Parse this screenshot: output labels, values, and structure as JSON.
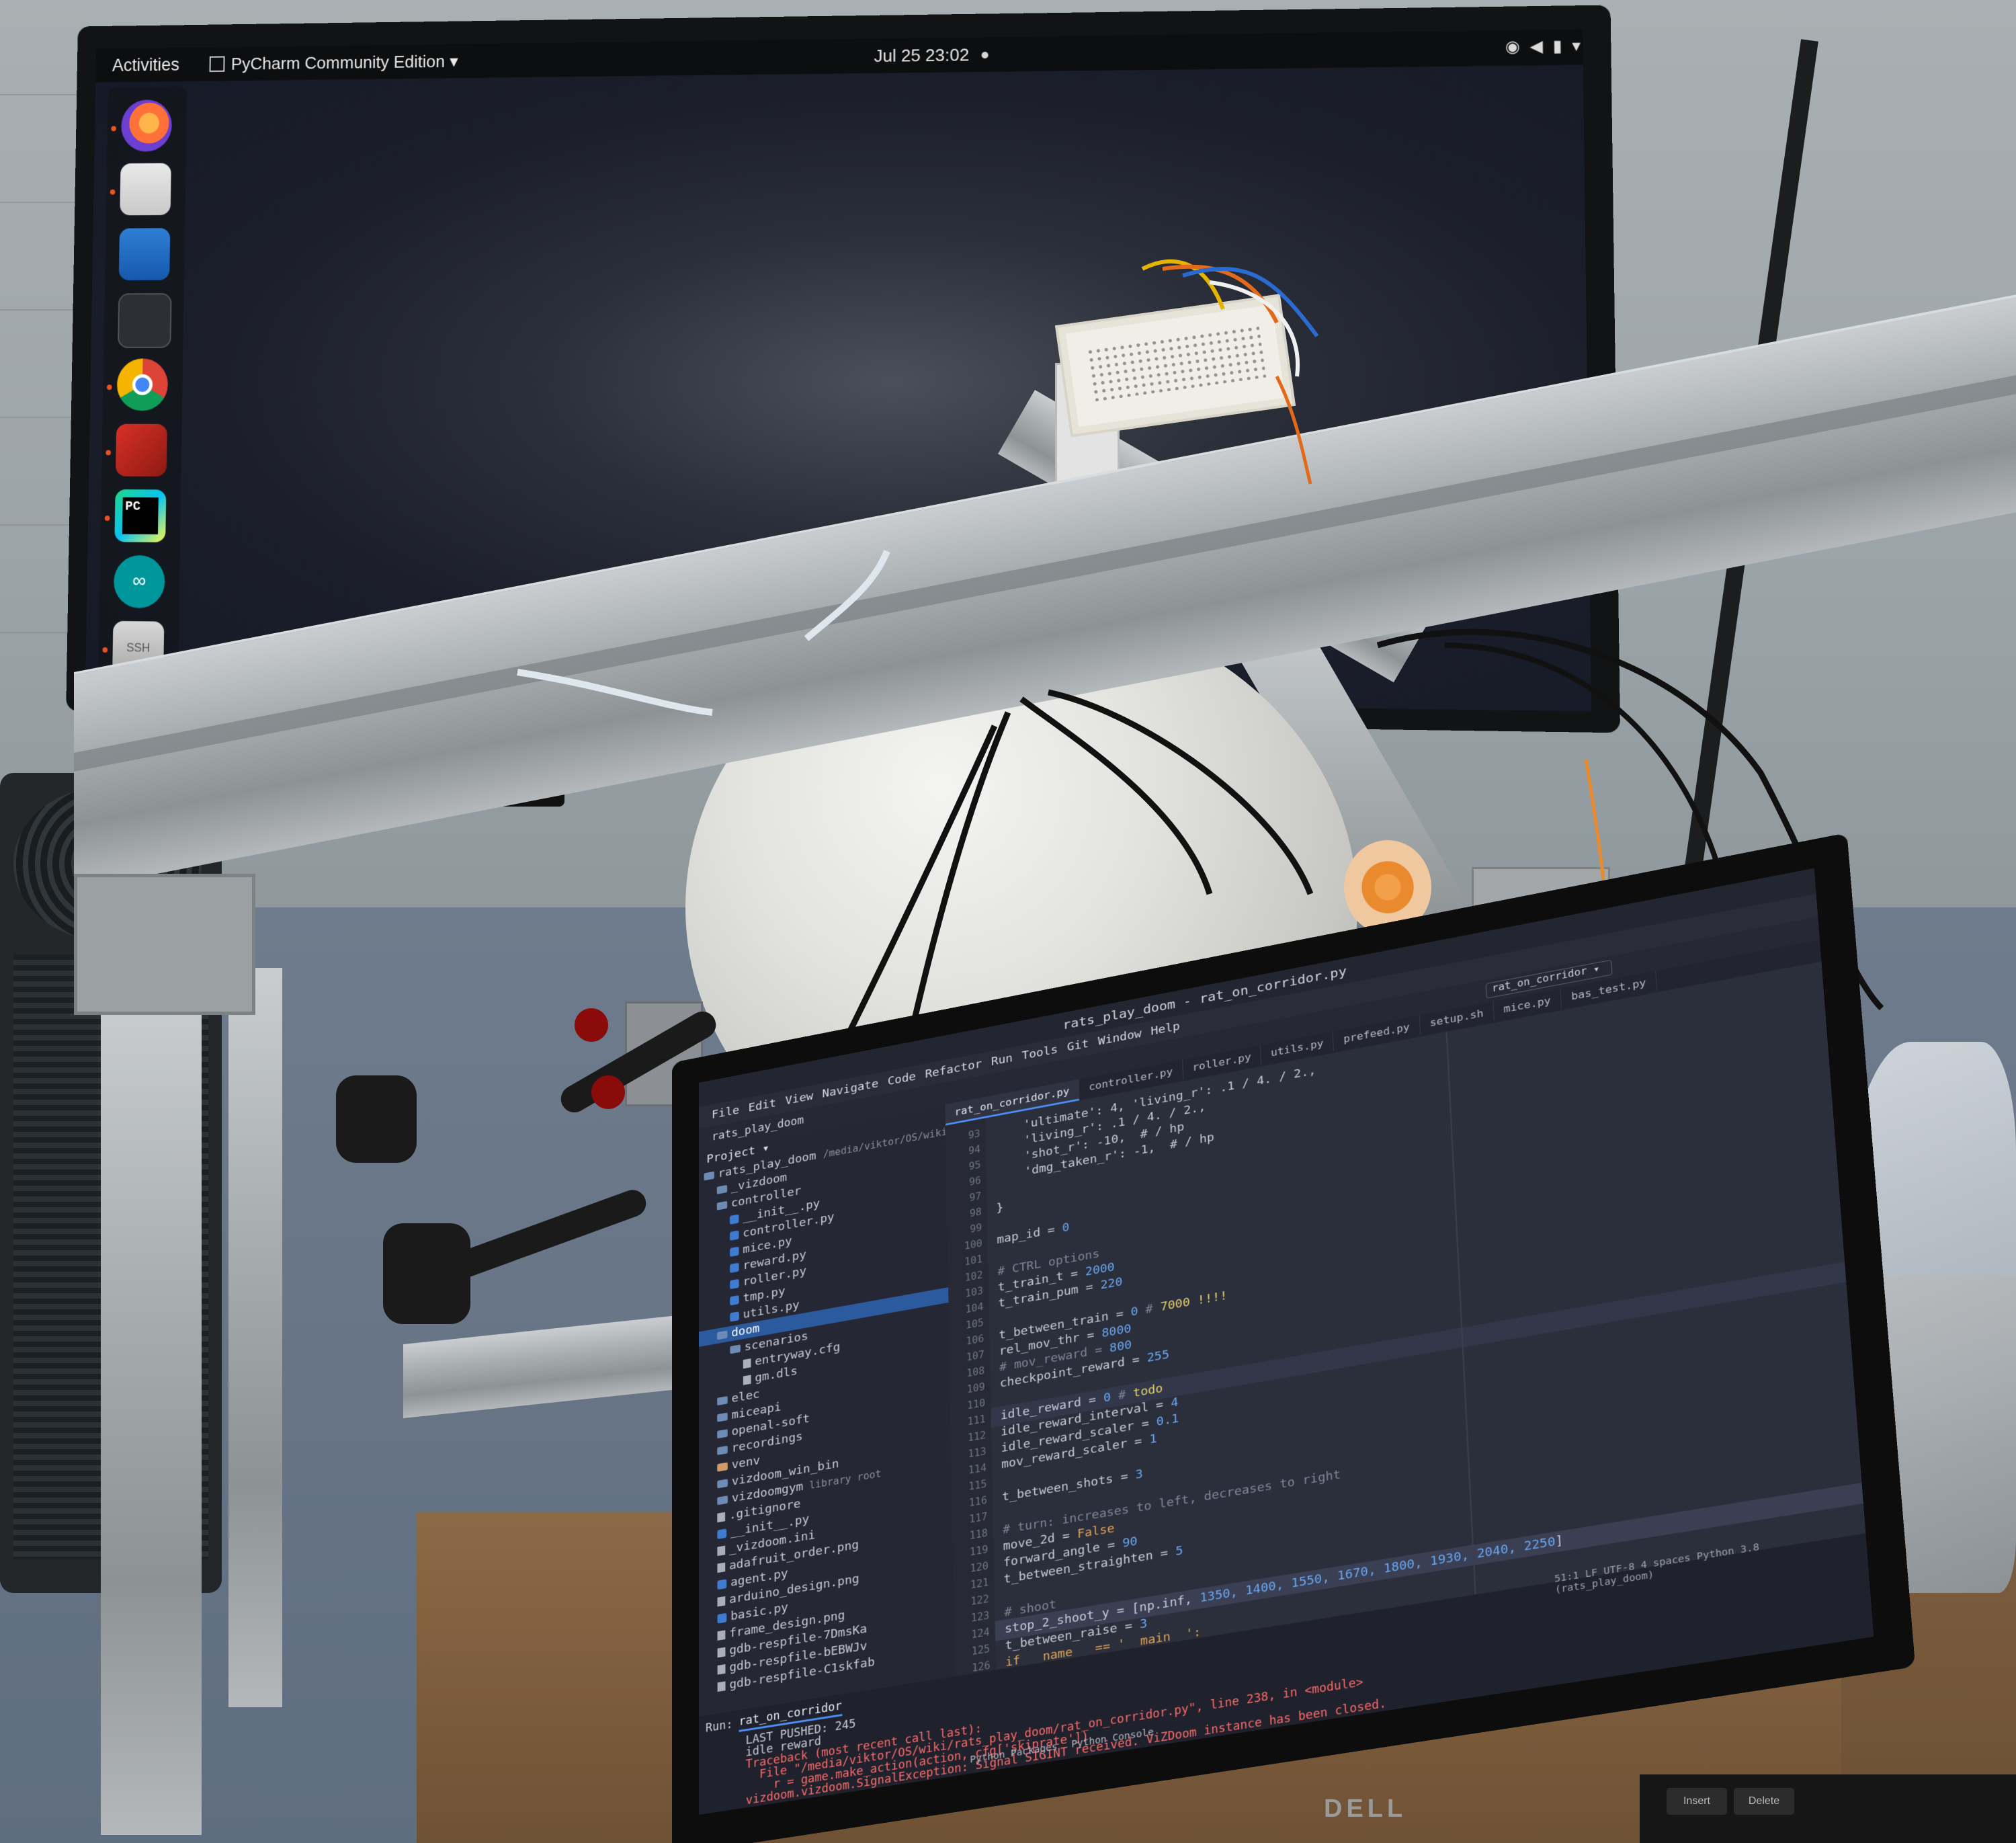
{
  "monitor": {
    "topbar": {
      "activities": "Activities",
      "app_menu": "PyCharm Community Edition ▾",
      "clock": "Jul 25  23:02"
    },
    "dock": {
      "items": [
        "firefox-icon",
        "files-icon",
        "libreoffice-writer-icon",
        "terminal-icon",
        "chrome-icon",
        "remote-desktop-icon",
        "pycharm-icon",
        "arduino-icon",
        "ssh-icon",
        "show-apps-icon"
      ],
      "pycharm_label": "PC",
      "arduino_label": "∞",
      "ssh_label": "SSH"
    }
  },
  "laptop": {
    "brand": "DELL",
    "keys": [
      "Insert",
      "Delete"
    ],
    "window_title": "rats_play_doom - rat_on_corridor.py",
    "menus": [
      "File",
      "Edit",
      "View",
      "Navigate",
      "Code",
      "Refactor",
      "Run",
      "Tools",
      "Git",
      "Window",
      "Help"
    ],
    "breadcrumb": "rats_play_doom",
    "run_config": "rat_on_corridor ▾",
    "tabs": [
      {
        "label": "rat_on_corridor.py",
        "active": true
      },
      {
        "label": "controller.py",
        "active": false
      },
      {
        "label": "roller.py",
        "active": false
      },
      {
        "label": "utils.py",
        "active": false
      },
      {
        "label": "prefeed.py",
        "active": false
      },
      {
        "label": "setup.sh",
        "active": false
      },
      {
        "label": "mice.py",
        "active": false
      },
      {
        "label": "bas_test.py",
        "active": false
      }
    ],
    "project": {
      "header": "Project ▾",
      "root": "rats_play_doom",
      "root_path": "/media/viktor/OS/wiki/ra",
      "items": [
        {
          "label": "_vizdoom",
          "kind": "folder",
          "indent": 1,
          "selected": false
        },
        {
          "label": "controller",
          "kind": "folder",
          "indent": 1,
          "selected": false
        },
        {
          "label": "__init__.py",
          "kind": "py",
          "indent": 2,
          "selected": false
        },
        {
          "label": "controller.py",
          "kind": "py",
          "indent": 2,
          "selected": false
        },
        {
          "label": "mice.py",
          "kind": "py",
          "indent": 2,
          "selected": false
        },
        {
          "label": "reward.py",
          "kind": "py",
          "indent": 2,
          "selected": false
        },
        {
          "label": "roller.py",
          "kind": "py",
          "indent": 2,
          "selected": false
        },
        {
          "label": "tmp.py",
          "kind": "py",
          "indent": 2,
          "selected": false
        },
        {
          "label": "utils.py",
          "kind": "py",
          "indent": 2,
          "selected": false
        },
        {
          "label": "doom",
          "kind": "folder",
          "indent": 1,
          "selected": true
        },
        {
          "label": "scenarios",
          "kind": "folder",
          "indent": 2,
          "selected": false
        },
        {
          "label": "entryway.cfg",
          "kind": "file",
          "indent": 3,
          "selected": false
        },
        {
          "label": "gm.dls",
          "kind": "file",
          "indent": 3,
          "selected": false
        },
        {
          "label": "elec",
          "kind": "folder",
          "indent": 1,
          "selected": false
        },
        {
          "label": "miceapi",
          "kind": "folder",
          "indent": 1,
          "selected": false
        },
        {
          "label": "openal-soft",
          "kind": "folder",
          "indent": 1,
          "selected": false
        },
        {
          "label": "recordings",
          "kind": "folder",
          "indent": 1,
          "selected": false
        },
        {
          "label": "venv",
          "kind": "venv",
          "indent": 1,
          "selected": false
        },
        {
          "label": "vizdoom_win_bin",
          "kind": "folder",
          "indent": 1,
          "selected": false
        },
        {
          "label": "vizdoomgym",
          "kind": "folder",
          "indent": 1,
          "selected": false,
          "note": "library root"
        },
        {
          "label": ".gitignore",
          "kind": "file",
          "indent": 1,
          "selected": false
        },
        {
          "label": "__init__.py",
          "kind": "py",
          "indent": 1,
          "selected": false
        },
        {
          "label": "_vizdoom.ini",
          "kind": "file",
          "indent": 1,
          "selected": false
        },
        {
          "label": "adafruit_order.png",
          "kind": "file",
          "indent": 1,
          "selected": false
        },
        {
          "label": "agent.py",
          "kind": "py",
          "indent": 1,
          "selected": false
        },
        {
          "label": "arduino_design.png",
          "kind": "file",
          "indent": 1,
          "selected": false
        },
        {
          "label": "basic.py",
          "kind": "py",
          "indent": 1,
          "selected": false
        },
        {
          "label": "frame_design.png",
          "kind": "file",
          "indent": 1,
          "selected": false
        },
        {
          "label": "gdb-respfile-7DmsKa",
          "kind": "file",
          "indent": 1,
          "selected": false
        },
        {
          "label": "gdb-respfile-bEBWJv",
          "kind": "file",
          "indent": 1,
          "selected": false
        },
        {
          "label": "gdb-respfile-C1skfab",
          "kind": "file",
          "indent": 1,
          "selected": false
        }
      ]
    },
    "code_lines": [
      {
        "n": "93",
        "segs": [
          {
            "t": "    'ultimate': 4, 'living_r': .1 / 4. / 2.,",
            "c": ""
          }
        ]
      },
      {
        "n": "94",
        "segs": [
          {
            "t": "    'living_r': .1 / 4. / 2.,",
            "c": ""
          }
        ]
      },
      {
        "n": "95",
        "segs": [
          {
            "t": "    'shot_r': -10,  # / hp",
            "c": ""
          }
        ]
      },
      {
        "n": "96",
        "segs": [
          {
            "t": "    'dmg_taken_r': -1,  # / hp",
            "c": ""
          }
        ]
      },
      {
        "n": "97",
        "segs": [
          {
            "t": "",
            "c": ""
          }
        ]
      },
      {
        "n": "98",
        "segs": [
          {
            "t": "}",
            "c": ""
          }
        ]
      },
      {
        "n": "99",
        "segs": [
          {
            "t": "",
            "c": ""
          }
        ]
      },
      {
        "n": "100",
        "segs": [
          {
            "t": "map_id = ",
            "c": ""
          },
          {
            "t": "0",
            "c": "num"
          }
        ]
      },
      {
        "n": "101",
        "segs": [
          {
            "t": "",
            "c": ""
          }
        ]
      },
      {
        "n": "102",
        "segs": [
          {
            "t": "# CTRL options",
            "c": "com"
          }
        ]
      },
      {
        "n": "103",
        "segs": [
          {
            "t": "t_train_t = ",
            "c": ""
          },
          {
            "t": "2000",
            "c": "num"
          }
        ]
      },
      {
        "n": "104",
        "segs": [
          {
            "t": "t_train_pum = ",
            "c": ""
          },
          {
            "t": "220",
            "c": "num"
          }
        ]
      },
      {
        "n": "105",
        "segs": [
          {
            "t": "",
            "c": ""
          }
        ]
      },
      {
        "n": "106",
        "segs": [
          {
            "t": "t_between_train = ",
            "c": ""
          },
          {
            "t": "0",
            "c": "num"
          },
          {
            "t": " # ",
            "c": "com"
          },
          {
            "t": "7000 !!!!",
            "c": "todo"
          }
        ]
      },
      {
        "n": "107",
        "segs": [
          {
            "t": "rel_mov_thr = ",
            "c": ""
          },
          {
            "t": "8000",
            "c": "num"
          }
        ]
      },
      {
        "n": "108",
        "segs": [
          {
            "t": "# mov_reward = ",
            "c": "com"
          },
          {
            "t": "800",
            "c": "num"
          }
        ]
      },
      {
        "n": "109",
        "segs": [
          {
            "t": "checkpoint_reward = ",
            "c": ""
          },
          {
            "t": "255",
            "c": "num"
          }
        ]
      },
      {
        "n": "110",
        "segs": [
          {
            "t": "",
            "c": ""
          }
        ]
      },
      {
        "n": "111",
        "segs": [
          {
            "t": "idle_reward = ",
            "c": ""
          },
          {
            "t": "0",
            "c": "num"
          },
          {
            "t": " # ",
            "c": "com"
          },
          {
            "t": "todo",
            "c": "todo"
          }
        ]
      },
      {
        "n": "112",
        "segs": [
          {
            "t": "idle_reward_interval = ",
            "c": ""
          },
          {
            "t": "4",
            "c": "num"
          }
        ]
      },
      {
        "n": "113",
        "segs": [
          {
            "t": "idle_reward_scaler = ",
            "c": ""
          },
          {
            "t": "0.1",
            "c": "num"
          }
        ]
      },
      {
        "n": "114",
        "segs": [
          {
            "t": "mov_reward_scaler = ",
            "c": ""
          },
          {
            "t": "1",
            "c": "num"
          }
        ]
      },
      {
        "n": "115",
        "segs": [
          {
            "t": "",
            "c": ""
          }
        ]
      },
      {
        "n": "116",
        "segs": [
          {
            "t": "t_between_shots = ",
            "c": ""
          },
          {
            "t": "3",
            "c": "num"
          }
        ]
      },
      {
        "n": "117",
        "segs": [
          {
            "t": "",
            "c": ""
          }
        ]
      },
      {
        "n": "118",
        "segs": [
          {
            "t": "# turn: increases to left, decreases to right",
            "c": "com"
          }
        ]
      },
      {
        "n": "119",
        "segs": [
          {
            "t": "move_2d = ",
            "c": ""
          },
          {
            "t": "False",
            "c": "kw"
          }
        ]
      },
      {
        "n": "120",
        "segs": [
          {
            "t": "forward_angle = ",
            "c": ""
          },
          {
            "t": "90",
            "c": "num"
          }
        ]
      },
      {
        "n": "121",
        "segs": [
          {
            "t": "t_between_straighten = ",
            "c": ""
          },
          {
            "t": "5",
            "c": "num"
          }
        ]
      },
      {
        "n": "122",
        "segs": [
          {
            "t": "",
            "c": ""
          }
        ]
      },
      {
        "n": "123",
        "segs": [
          {
            "t": "# shoot",
            "c": "com"
          }
        ]
      },
      {
        "n": "124",
        "segs": [
          {
            "t": "stop_2_shoot_y = [np.inf, ",
            "c": ""
          },
          {
            "t": "1350, 1400, 1550, 1670, 1800, 1930, 2040, 2250",
            "c": "num"
          },
          {
            "t": "]",
            "c": ""
          }
        ]
      },
      {
        "n": "125",
        "segs": [
          {
            "t": "t_between_raise = ",
            "c": ""
          },
          {
            "t": "3",
            "c": "num"
          }
        ]
      },
      {
        "n": "126",
        "segs": [
          {
            "t": "if __name__ == '__main__':",
            "c": "kw"
          }
        ]
      }
    ],
    "status": "51:1  LF  UTF-8  4 spaces  Python 3.8 (rats_play_doom)",
    "run": {
      "label": "Run:",
      "tab": "rat_on_corridor",
      "lines": [
        {
          "t": "LAST PUSHED: 245",
          "c": ""
        },
        {
          "t": "idle reward",
          "c": ""
        },
        {
          "t": "Traceback (most recent call last):",
          "c": "err"
        },
        {
          "t": "  File \"/media/viktor/OS/wiki/rats_play_doom/rat_on_corridor.py\", line 238, in <module>",
          "c": "err"
        },
        {
          "t": "    r = game.make_action(action, cfg['skiprate'])",
          "c": "err"
        },
        {
          "t": "vizdoom.vizdoom.SignalException: Signal SIGINT received. ViZDoom instance has been closed.",
          "c": "err"
        }
      ]
    },
    "bottom_tabs": [
      "Python Packages",
      "Python Console"
    ]
  }
}
